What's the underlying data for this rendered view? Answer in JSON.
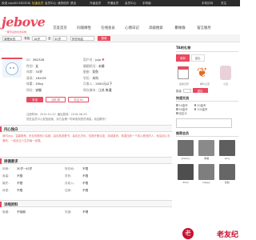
{
  "topbar": {
    "welcome": "欢迎 jojo(ID:362326)",
    "vip": "恰逢会员",
    "member_center": "会员中心",
    "msg": "我的信件",
    "logout": "退出",
    "links": [
      "升级会员",
      "开通会员",
      "会员中心",
      "手机版"
    ],
    "right": [
      "手机访问",
      "关注"
    ]
  },
  "header": {
    "logo": "jebove",
    "logo_sub": "一都专业的交友系统",
    "nav": [
      "交友首页",
      "同城缘性",
      "在线会员",
      "心情日记",
      "高级搜索",
      "聚缘群",
      "留言服务"
    ]
  },
  "searchbar": {
    "sex": "我是女性",
    "looking": "寻找",
    "age_from": "18岁",
    "to": "至",
    "age_to": "30岁",
    "area": "所在地区",
    "btn": "搜索"
  },
  "profile": {
    "col1": [
      {
        "k": "昵称：",
        "v": "jojo"
      },
      {
        "k": "ID：",
        "v": "362326"
      },
      {
        "k": "性别：",
        "v": "女"
      },
      {
        "k": "年龄：",
        "v": "34岁"
      },
      {
        "k": "身高：",
        "v": "162CM"
      },
      {
        "k": "体重：",
        "v": "45kg"
      },
      {
        "k": "学历：",
        "v": "本科"
      },
      {
        "k": "职业：",
        "v": "IT业"
      },
      {
        "k": "所在：",
        "v": "安徽"
      }
    ],
    "col2": [
      {
        "k": "用户名：",
        "v": "jojo"
      },
      {
        "k": "婚姻状况：",
        "v": "未婚"
      },
      {
        "k": "星座：",
        "v": "双鱼"
      },
      {
        "k": "血型：",
        "v": "A型"
      },
      {
        "k": "民族：",
        "v": "汉族"
      },
      {
        "k": "月收入：",
        "v": "2000元以下"
      },
      {
        "k": "住房：",
        "v": "单位宿舍"
      },
      {
        "k": "所在城市：",
        "v": "江苏 南通"
      }
    ],
    "btn_msg": "发信",
    "btn_gift": "送礼物",
    "btn_follow": "关注TA",
    "meta1": "注册时间：2015-01-22",
    "meta1b": "最后登录：2016-08-29",
    "meta2": "您在会员中心发信给她，对方会第一时间收到您的消息，欢迎联系！"
  },
  "sections": {
    "mono": "内心独白",
    "mono_text": "我叫jojo，温馨聪慧，来自安徽的小姑娘。喜欢旅游看书，喜欢出去玩，性格开朗活泼，真诚善良，希望找到一个真心爱我的人，我会用心去爱他，一起走过人生的每一段路。",
    "req": "择偶要求",
    "req_rows": [
      {
        "a": "年龄：",
        "av": "30岁~40岁",
        "b": "所在地：",
        "bv": "不限"
      },
      {
        "a": "身高：",
        "av": "不限",
        "b": "学历：",
        "bv": "不限"
      },
      {
        "a": "婚史：",
        "av": "不限",
        "b": "月收入：",
        "bv": "不限"
      },
      {
        "a": "体型：",
        "av": "不限",
        "b": "住房：",
        "bv": "不限"
      }
    ],
    "more": "详细资料",
    "more_rows": [
      {
        "a": "吸烟：",
        "av": "不吸烟",
        "b": "饮酒：",
        "bv": "不喝"
      }
    ]
  },
  "sidebar": {
    "gift_head": "TA的礼物",
    "gift_tabs": [
      "收到",
      "送出"
    ],
    "gifts": [
      "爱的日历",
      "枫叶之恋",
      "小丑"
    ],
    "qty_label": "数量",
    "send": "送出",
    "fast_head": "快速交流",
    "fast_opts": [
      [
        "10金币",
        "20金币"
      ],
      [
        "50金币",
        "100金币"
      ]
    ],
    "custom_label": "自定义",
    "photo_head": "推荐会员",
    "people": [
      {
        "name": "jmlerry",
        "sub": "上海 32岁"
      },
      {
        "name": "幸福",
        "sub": "江苏 25岁"
      },
      {
        "name": "amy",
        "sub": "山东 28岁"
      },
      {
        "name": "Shan",
        "sub": "广东 30岁"
      },
      {
        "name": "happy",
        "sub": "北京 29岁"
      },
      {
        "name": "秋秋",
        "sub": "浙江 27岁"
      },
      {
        "name": "jolin",
        "sub": "湖南 31岁"
      },
      {
        "name": "小梦",
        "sub": "湖北 26岁"
      },
      {
        "name": "alex",
        "sub": "河南 33岁"
      }
    ]
  },
  "watermark": "老友纪",
  "colors": {
    "accent": "#e84a5f",
    "topbar": "#2b2b2b",
    "section_bg": "#f7f7f7"
  }
}
